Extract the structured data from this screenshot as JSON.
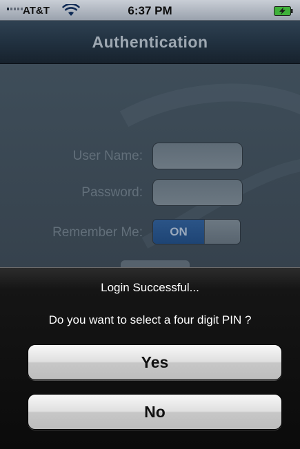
{
  "status_bar": {
    "carrier": "AT&T",
    "time": "6:37 PM",
    "icons": [
      "signal-icon",
      "wifi-icon",
      "battery-charging-icon"
    ]
  },
  "nav_bar": {
    "title": "Authentication"
  },
  "form": {
    "username_label": "User Name:",
    "username_value": "",
    "password_label": "Password:",
    "password_value": "",
    "remember_label": "Remember Me:",
    "remember_state": "ON"
  },
  "action_sheet": {
    "title": "Login Successful...",
    "message": "Do you want to select a four digit PIN ?",
    "yes_label": "Yes",
    "no_label": "No"
  },
  "colors": {
    "nav_bar": "#213140",
    "toggle_on": "#1e4474",
    "sheet_background": "#0b0b0b",
    "button_face": "#e0e0e0"
  }
}
